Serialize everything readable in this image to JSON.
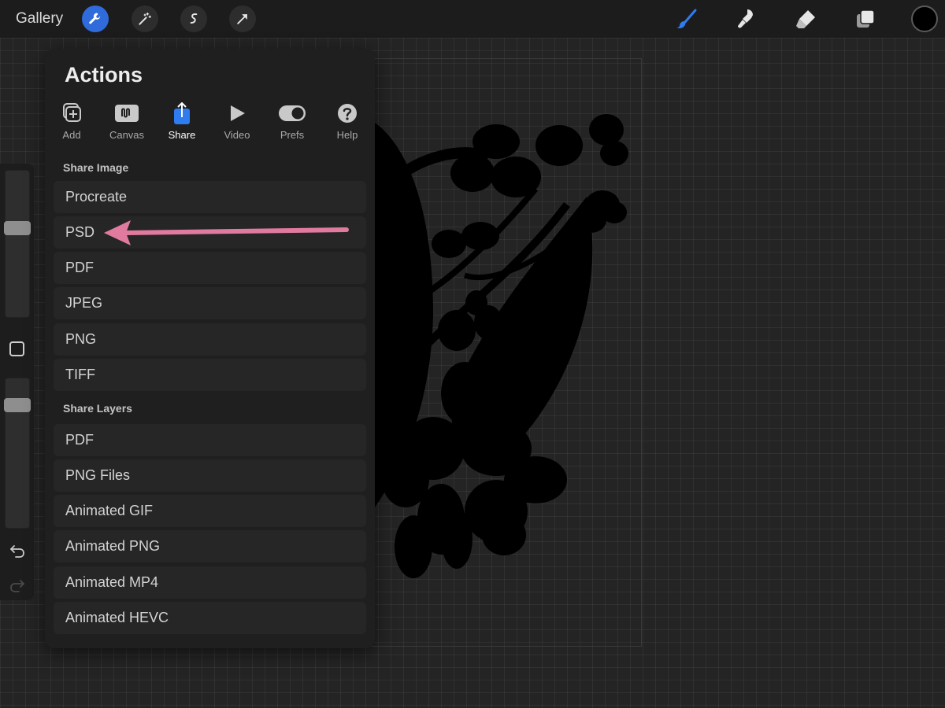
{
  "topbar": {
    "gallery_label": "Gallery",
    "left_tools": [
      "wrench-icon",
      "magic-wand-icon",
      "selection-icon",
      "transform-icon"
    ],
    "right_tools": [
      "brush-icon",
      "smudge-icon",
      "eraser-icon",
      "layers-icon"
    ],
    "active_tool_color": "#2f6bdb",
    "current_color": "#000000"
  },
  "panel": {
    "title": "Actions",
    "tabs": [
      {
        "label": "Add",
        "icon": "add-image-icon"
      },
      {
        "label": "Canvas",
        "icon": "canvas-icon"
      },
      {
        "label": "Share",
        "icon": "share-icon",
        "active": true
      },
      {
        "label": "Video",
        "icon": "play-icon"
      },
      {
        "label": "Prefs",
        "icon": "toggle-icon"
      },
      {
        "label": "Help",
        "icon": "question-icon"
      }
    ],
    "share_image_title": "Share Image",
    "share_image_items": [
      "Procreate",
      "PSD",
      "PDF",
      "JPEG",
      "PNG",
      "TIFF"
    ],
    "share_layers_title": "Share Layers",
    "share_layers_items": [
      "PDF",
      "PNG Files",
      "Animated GIF",
      "Animated PNG",
      "Animated MP4",
      "Animated HEVC"
    ]
  },
  "annotation": {
    "arrow_color": "#e07a9f",
    "points_to": "PSD"
  },
  "sidebar": {
    "brush_size": 0.62,
    "opacity": 0.85
  }
}
